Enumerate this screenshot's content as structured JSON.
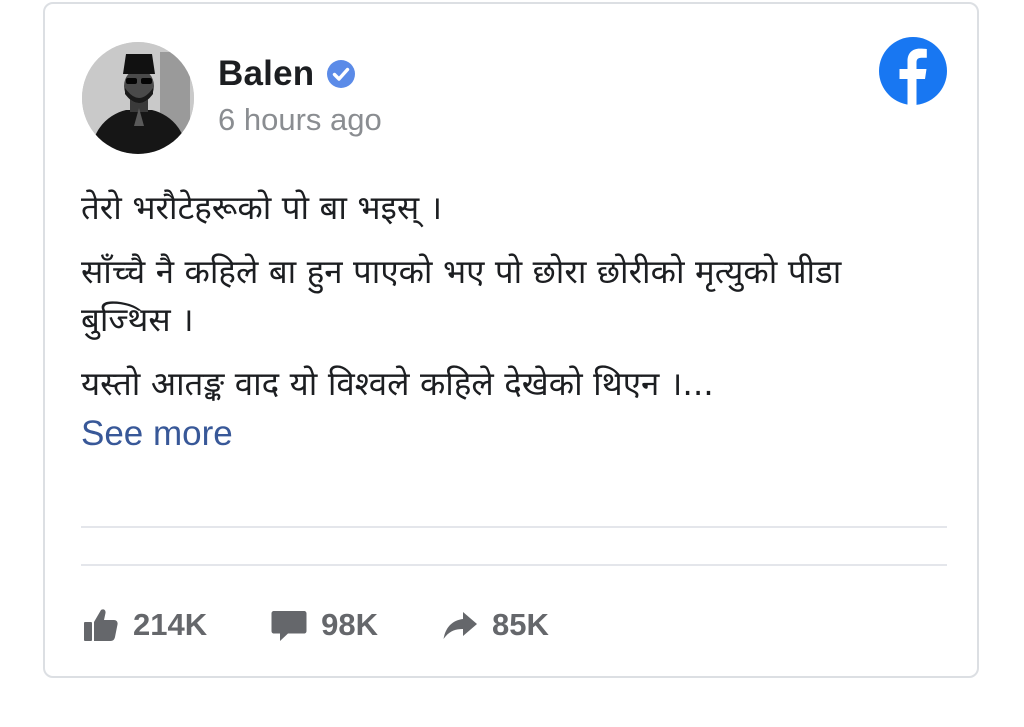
{
  "post": {
    "author": "Balen",
    "verified": true,
    "timestamp": "6 hours ago",
    "paragraphs": [
      "तेरो भरौटेहरूको पो बा भइस् ।",
      "साँच्चै नै कहिले बा हुन पाएको भए पो छोरा छोरीको मृत्युको पीडा बुज्थिस ।",
      "यस्तो आतङ्क वाद यो विश्वले कहिले देखेको थिएन ।..."
    ],
    "see_more_label": "See more"
  },
  "stats": {
    "likes": "214K",
    "comments": "98K",
    "shares": "85K"
  },
  "icons": {
    "brand": "facebook-logo-icon",
    "verified": "verified-badge-icon",
    "like": "thumbs-up-icon",
    "comment": "comment-bubble-icon",
    "share": "share-arrow-icon"
  },
  "colors": {
    "facebook_blue": "#1877f2",
    "link": "#385898",
    "muted": "#8a8d91",
    "stat_gray": "#65676b"
  }
}
